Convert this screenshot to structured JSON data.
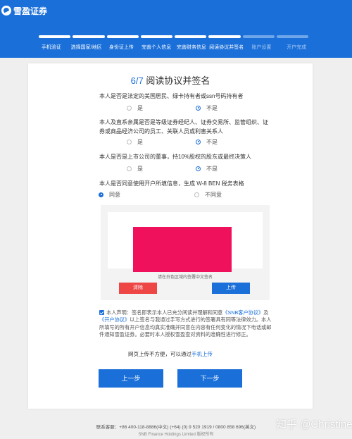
{
  "header": {
    "brand": "雪盈证券",
    "steps": [
      {
        "label": "手机验证",
        "done": true
      },
      {
        "label": "选择国家/地区",
        "done": true
      },
      {
        "label": "身份证上传",
        "done": true
      },
      {
        "label": "完善个人信息",
        "done": true
      },
      {
        "label": "完善财务信息",
        "done": true
      },
      {
        "label": "阅读协议并签名",
        "done": true
      },
      {
        "label": "账户设置",
        "done": false
      },
      {
        "label": "开户完成",
        "done": false
      }
    ],
    "progress_fraction": 0.75
  },
  "form": {
    "step_num": "6",
    "step_total": "/7",
    "title": "阅读协议并签名",
    "questions": [
      {
        "text": "本人是否是法定的美国居民、绿卡持有者或ssn号码持有者",
        "yes": "是",
        "no": "不是",
        "selected": "no"
      },
      {
        "text": "本人及直系亲属是否是等级证券经纪人、证券交易所、监管组织、证券或商品经济公司的员工、关联人员或利害关系人",
        "yes": "是",
        "no": "不是",
        "selected": "no"
      },
      {
        "text": "本人是否是上市公司的董事，持10%股权的股东或最终决策人",
        "yes": "是",
        "no": "不是",
        "selected": "no"
      },
      {
        "text": "本人是否同意使用开户所填信息，生成 W-8 BEN 税务表格",
        "yes": "同意",
        "no": "不同意",
        "selected": "yes"
      }
    ],
    "signature": {
      "hint": "请在白色区域内签署中文签名",
      "clear_label": "清除",
      "upload_label": "上传"
    },
    "declaration": {
      "checked": true,
      "part1": "本人声明：签名即表示本人已充分阅读并理解和同意",
      "link1": "《SNB客户协议》",
      "part2": "及",
      "link2": "《开户协议》",
      "part3": "以上签名与我通过手写方式进行的签署具有同等法律效力。本人所填写的所有开户信息均真实准确并同意在内容有任何变化的情况下电话或邮件通知雪盈证券。必要时本人授权雪盈查对资料的准确性进行修正。"
    },
    "alt_text": "网页上传不方便，可以通过",
    "alt_link": "手机上传",
    "prev_label": "上一步",
    "next_label": "下一步"
  },
  "footer": {
    "contact": "联系客服：+86 400-118-8886(中文) (+64) (0) 9 520 1919 / 0800 858 696(英文)",
    "copyright": "SNB Finance Holdings Limited 版权所有"
  },
  "watermark": "知乎 @Christine",
  "colors": {
    "primary": "#1a6fd9",
    "danger": "#ee4545",
    "signature_fill": "#f0115d"
  }
}
